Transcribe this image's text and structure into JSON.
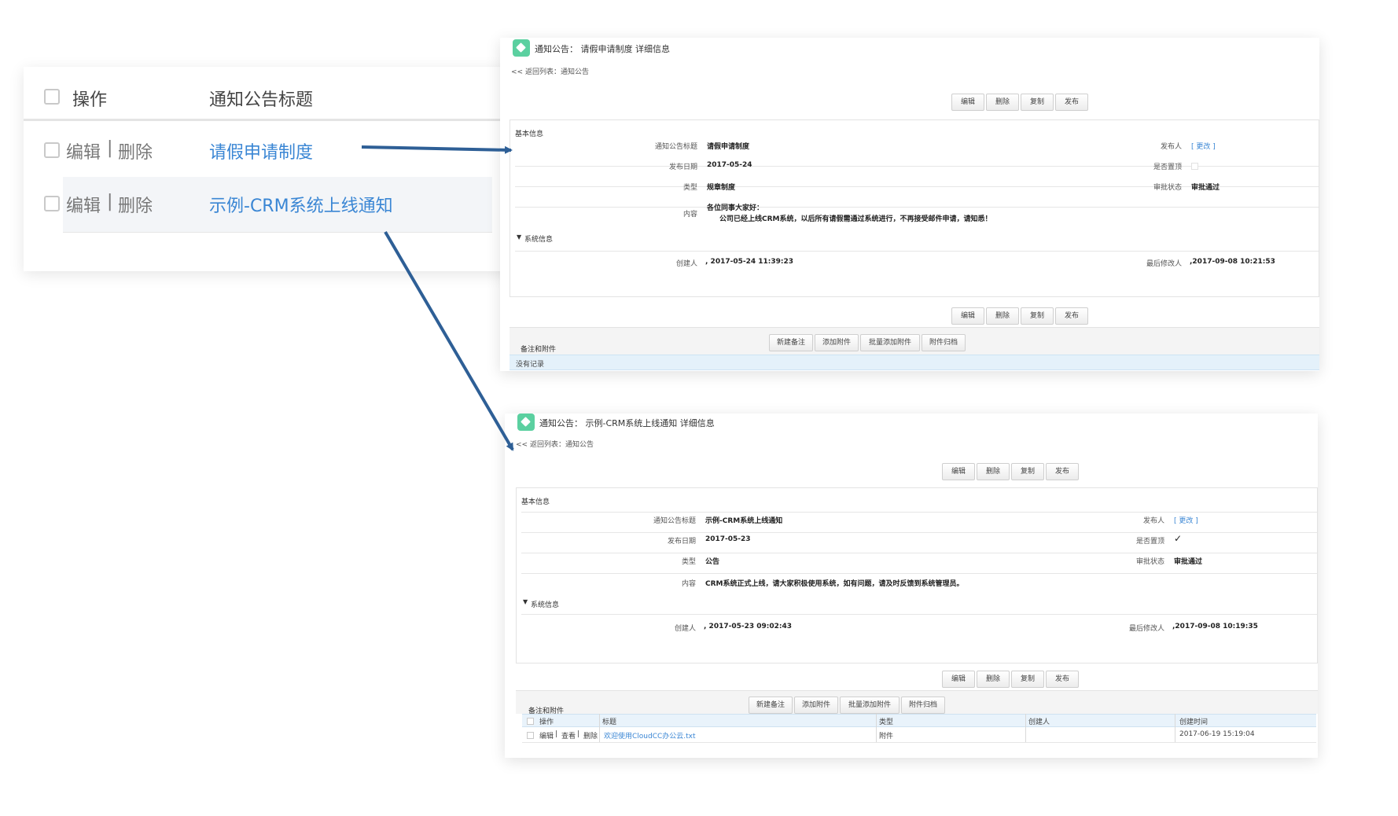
{
  "list": {
    "header": {
      "ops": "操作",
      "title": "通知公告标题"
    },
    "rows": [
      {
        "edit": "编辑",
        "sep": "|",
        "delete": "删除",
        "title": "请假申请制度"
      },
      {
        "edit": "编辑",
        "sep": "|",
        "delete": "删除",
        "title": "示例-CRM系统上线通知"
      }
    ]
  },
  "detail1": {
    "title": "通知公告： 请假申请制度  详细信息",
    "back": "<< 返回列表：通知公告",
    "buttons": [
      "编辑",
      "删除",
      "复制",
      "发布"
    ],
    "section": "基本信息",
    "fields": {
      "title_label": "通知公告标题",
      "title_value": "请假申请制度",
      "publisher_label": "发布人",
      "publisher_link": "[ 更改 ]",
      "date_label": "发布日期",
      "date_value": "2017-05-24",
      "top_label": "是否置顶",
      "type_label": "类型",
      "type_value": "规章制度",
      "status_label": "审批状态",
      "status_value": "审批通过",
      "content_label": "内容",
      "content_line1": "各位同事大家好：",
      "content_line2": "公司已经上线CRM系统，以后所有请假需通过系统进行，不再接受邮件申请，请知悉！"
    },
    "system": {
      "toggle": "▼",
      "label": "系统信息",
      "creator_label": "创建人",
      "creator_value": ", 2017-05-24 11:39:23",
      "modifier_label": "最后修改人",
      "modifier_value": ",2017-09-08 10:21:53"
    },
    "notes": {
      "label": "备注和附件",
      "buttons": [
        "新建备注",
        "添加附件",
        "批量添加附件",
        "附件归档"
      ],
      "empty": "没有记录"
    }
  },
  "detail2": {
    "title": "通知公告： 示例-CRM系统上线通知  详细信息",
    "back": "<< 返回列表：通知公告",
    "buttons": [
      "编辑",
      "删除",
      "复制",
      "发布"
    ],
    "section": "基本信息",
    "fields": {
      "title_label": "通知公告标题",
      "title_value": "示例-CRM系统上线通知",
      "publisher_label": "发布人",
      "publisher_link": "[ 更改 ]",
      "date_label": "发布日期",
      "date_value": "2017-05-23",
      "top_label": "是否置顶",
      "top_value": "✓",
      "type_label": "类型",
      "type_value": "公告",
      "status_label": "审批状态",
      "status_value": "审批通过",
      "content_label": "内容",
      "content_value": "CRM系统正式上线，请大家积极使用系统，如有问题，请及时反馈到系统管理员。"
    },
    "system": {
      "toggle": "▼",
      "label": "系统信息",
      "creator_label": "创建人",
      "creator_value": ", 2017-05-23 09:02:43",
      "modifier_label": "最后修改人",
      "modifier_value": ",2017-09-08 10:19:35"
    },
    "notes": {
      "label": "备注和附件",
      "buttons": [
        "新建备注",
        "添加附件",
        "批量添加附件",
        "附件归档"
      ],
      "columns": [
        "操作",
        "标题",
        "类型",
        "创建人",
        "创建时间"
      ],
      "row": {
        "edit": "编辑",
        "view": "查看",
        "delete": "删除",
        "sep": "|",
        "title": "欢迎使用CloudCC办公云.txt",
        "type": "附件",
        "creator": "",
        "time": "2017-06-19 15:19:04"
      }
    }
  },
  "colors": {
    "link": "#3a86d4",
    "arrow": "#2e5f96",
    "logo": "#5bd0a0"
  }
}
